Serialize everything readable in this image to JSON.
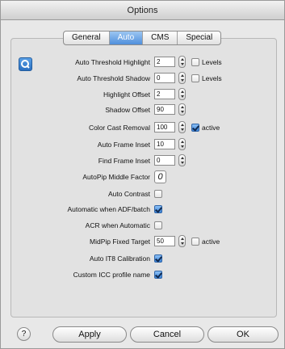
{
  "window": {
    "title": "Options"
  },
  "tabs": [
    {
      "label": "General",
      "active": false
    },
    {
      "label": "Auto",
      "active": true
    },
    {
      "label": "CMS",
      "active": false
    },
    {
      "label": "Special",
      "active": false
    }
  ],
  "settings": {
    "auto_threshold_highlight": {
      "label": "Auto Threshold Highlight",
      "value": "2",
      "check_label": "Levels",
      "checked": false
    },
    "auto_threshold_shadow": {
      "label": "Auto Threshold Shadow",
      "value": "0",
      "check_label": "Levels",
      "checked": false
    },
    "highlight_offset": {
      "label": "Highlight Offset",
      "value": "2"
    },
    "shadow_offset": {
      "label": "Shadow Offset",
      "value": "90"
    },
    "color_cast_removal": {
      "label": "Color Cast Removal",
      "value": "100",
      "check_label": "active",
      "checked": true
    },
    "auto_frame_inset": {
      "label": "Auto Frame Inset",
      "value": "10"
    },
    "find_frame_inset": {
      "label": "Find Frame Inset",
      "value": "0"
    },
    "autopip_middle_factor": {
      "label": "AutoPip Middle Factor",
      "value": "0"
    },
    "auto_contrast": {
      "label": "Auto Contrast",
      "checked": false
    },
    "automatic_when_adf": {
      "label": "Automatic when ADF/batch",
      "checked": true
    },
    "acr_when_automatic": {
      "label": "ACR when Automatic",
      "checked": false
    },
    "midpip_fixed_target": {
      "label": "MidPip Fixed Target",
      "value": "50",
      "check_label": "active",
      "checked": false
    },
    "auto_it8_calibration": {
      "label": "Auto IT8 Calibration",
      "checked": true
    },
    "custom_icc_profile_name": {
      "label": "Custom ICC profile name",
      "checked": true
    }
  },
  "buttons": {
    "help": "?",
    "apply": "Apply",
    "cancel": "Cancel",
    "ok": "OK"
  },
  "colors": {
    "active_tab": "#4f8fdc",
    "checkbox_checked": "#3d84d8"
  }
}
